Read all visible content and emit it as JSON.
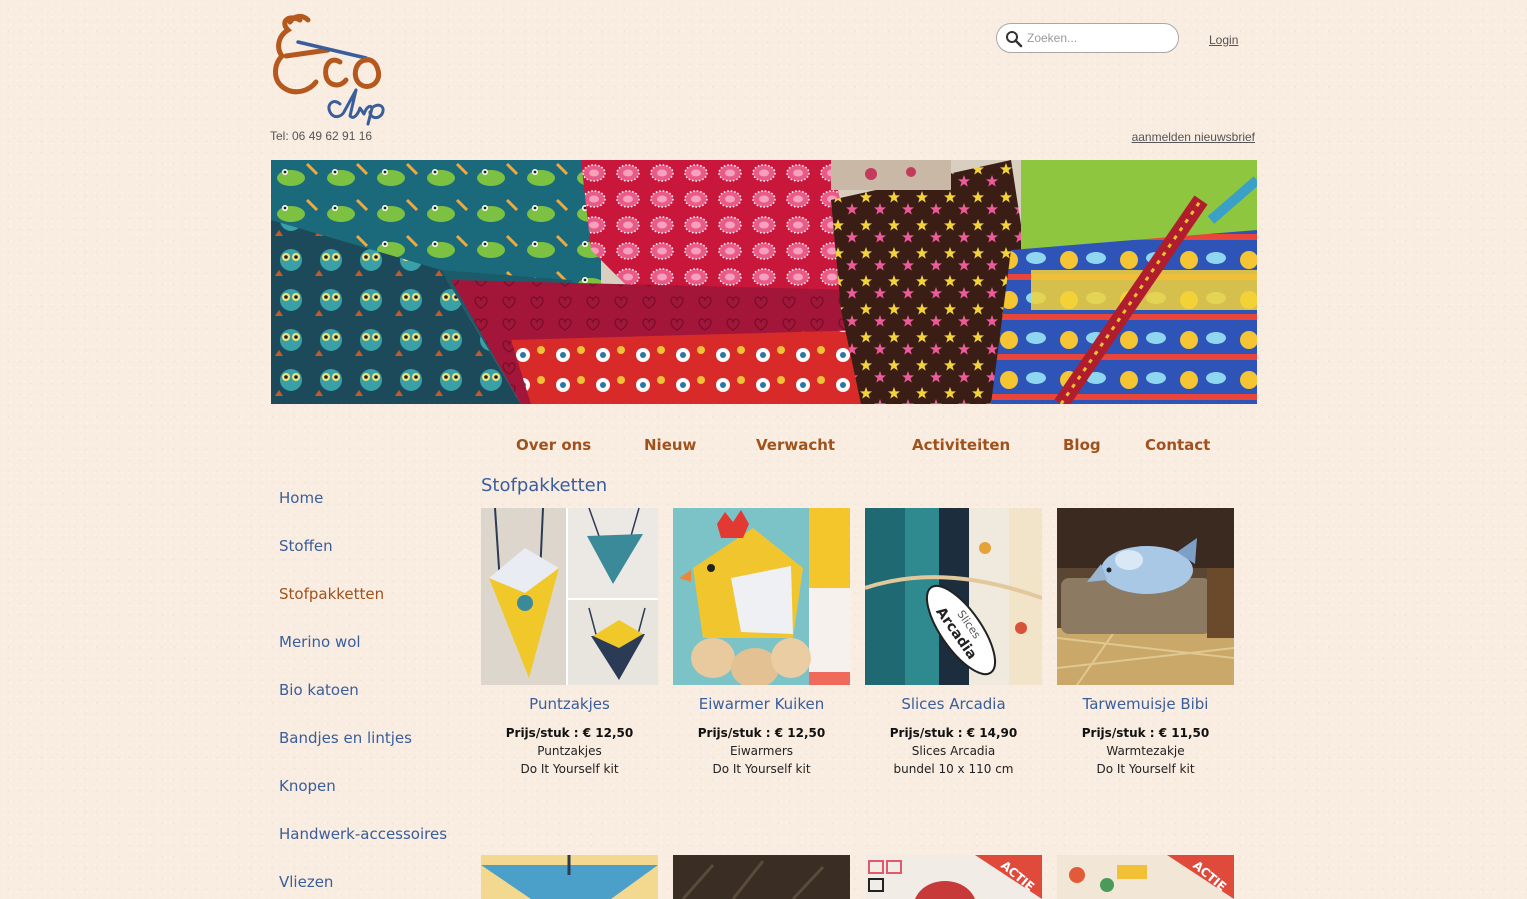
{
  "header": {
    "logo_alt": "Eco clip",
    "phone": "Tel: 06 49 62 91 16",
    "search_placeholder": "Zoeken...",
    "login_label": "Login",
    "newsletter_label": "aanmelden nieuwsbrief"
  },
  "topnav": {
    "items": [
      {
        "label": "Over ons"
      },
      {
        "label": "Nieuw"
      },
      {
        "label": "Verwacht"
      },
      {
        "label": "Activiteiten"
      },
      {
        "label": "Blog"
      },
      {
        "label": "Contact"
      }
    ]
  },
  "sidebar": {
    "items": [
      {
        "label": "Home"
      },
      {
        "label": "Stoffen"
      },
      {
        "label": "Stofpakketten",
        "active": true
      },
      {
        "label": "Merino wol"
      },
      {
        "label": "Bio katoen"
      },
      {
        "label": "Bandjes en lintjes"
      },
      {
        "label": "Knopen"
      },
      {
        "label": "Handwerk-accessoires"
      },
      {
        "label": "Vliezen"
      }
    ]
  },
  "main": {
    "title": "Stofpakketten",
    "products": [
      {
        "name": "Puntzakjes",
        "price": "Prijs/stuk : € 12,50",
        "line1": "Puntzakjes",
        "line2": "Do It Yourself kit"
      },
      {
        "name": "Eiwarmer Kuiken",
        "price": "Prijs/stuk : € 12,50",
        "line1": "Eiwarmers",
        "line2": "Do It Yourself kit"
      },
      {
        "name": "Slices Arcadia",
        "price": "Prijs/stuk : € 14,90",
        "line1": "Slices Arcadia",
        "line2": "bundel 10 x 110 cm"
      },
      {
        "name": "Tarwemuisje Bibi",
        "price": "Prijs/stuk : € 11,50",
        "line1": "Warmtezakje",
        "line2": "Do It Yourself kit"
      }
    ],
    "second_row_badges": [
      "ACTIE",
      "ACTIE"
    ],
    "slices_label": "Slices",
    "arcadia_label": "Arcadia"
  },
  "colors": {
    "background": "#f9ece0",
    "nav_brown": "#a0521d",
    "link_blue": "#3a5d9c"
  }
}
